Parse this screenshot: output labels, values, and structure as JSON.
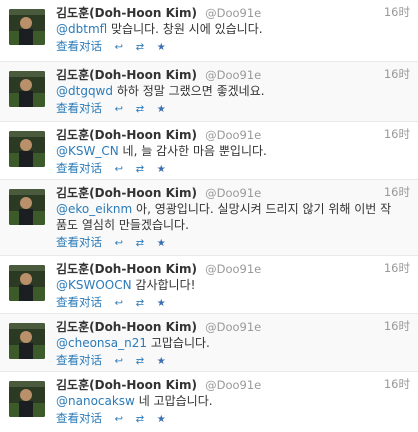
{
  "colors": {
    "link": "#2b7bb9",
    "meta_gray": "#999999",
    "text": "#333333",
    "row_alt": "#f9f9f9"
  },
  "icons": {
    "reply": "reply-icon",
    "retweet": "retweet-icon",
    "favorite": "star-icon"
  },
  "tweets": [
    {
      "name": "김도훈(Doh-Hoon Kim)",
      "handle": "@Doo91e",
      "time": "16时",
      "mention": "@dbtmfl",
      "text": " 맞습니다. 창원 시에 있습니다.",
      "view_label": "查看对话",
      "reply_glyph": "↩",
      "retweet_glyph": "⇄",
      "favorite_glyph": "★"
    },
    {
      "name": "김도훈(Doh-Hoon Kim)",
      "handle": "@Doo91e",
      "time": "16时",
      "mention": "@dtgqwd",
      "text": " 하하 정말 그랬으면 좋겠네요.",
      "view_label": "查看对话",
      "reply_glyph": "↩",
      "retweet_glyph": "⇄",
      "favorite_glyph": "★"
    },
    {
      "name": "김도훈(Doh-Hoon Kim)",
      "handle": "@Doo91e",
      "time": "16时",
      "mention": "@KSW_CN",
      "text": " 네, 늘 감사한 마음 뿐입니다.",
      "view_label": "查看对话",
      "reply_glyph": "↩",
      "retweet_glyph": "⇄",
      "favorite_glyph": "★"
    },
    {
      "name": "김도훈(Doh-Hoon Kim)",
      "handle": "@Doo91e",
      "time": "16时",
      "mention": "@eko_eiknm",
      "text": " 아, 영광입니다. 실망시켜 드리지 않기 위해 이번 작품도 열심히 만들겠습니다.",
      "view_label": "查看对话",
      "reply_glyph": "↩",
      "retweet_glyph": "⇄",
      "favorite_glyph": "★"
    },
    {
      "name": "김도훈(Doh-Hoon Kim)",
      "handle": "@Doo91e",
      "time": "16时",
      "mention": "@KSWOOCN",
      "text": " 감사합니다!",
      "view_label": "查看对话",
      "reply_glyph": "↩",
      "retweet_glyph": "⇄",
      "favorite_glyph": "★"
    },
    {
      "name": "김도훈(Doh-Hoon Kim)",
      "handle": "@Doo91e",
      "time": "16时",
      "mention": "@cheonsa_n21",
      "text": " 고맙습니다.",
      "view_label": "查看对话",
      "reply_glyph": "↩",
      "retweet_glyph": "⇄",
      "favorite_glyph": "★"
    },
    {
      "name": "김도훈(Doh-Hoon Kim)",
      "handle": "@Doo91e",
      "time": "16时",
      "mention": "@nanocaksw",
      "text": " 네 고맙습니다.",
      "view_label": "查看对话",
      "reply_glyph": "↩",
      "retweet_glyph": "⇄",
      "favorite_glyph": "★"
    }
  ]
}
